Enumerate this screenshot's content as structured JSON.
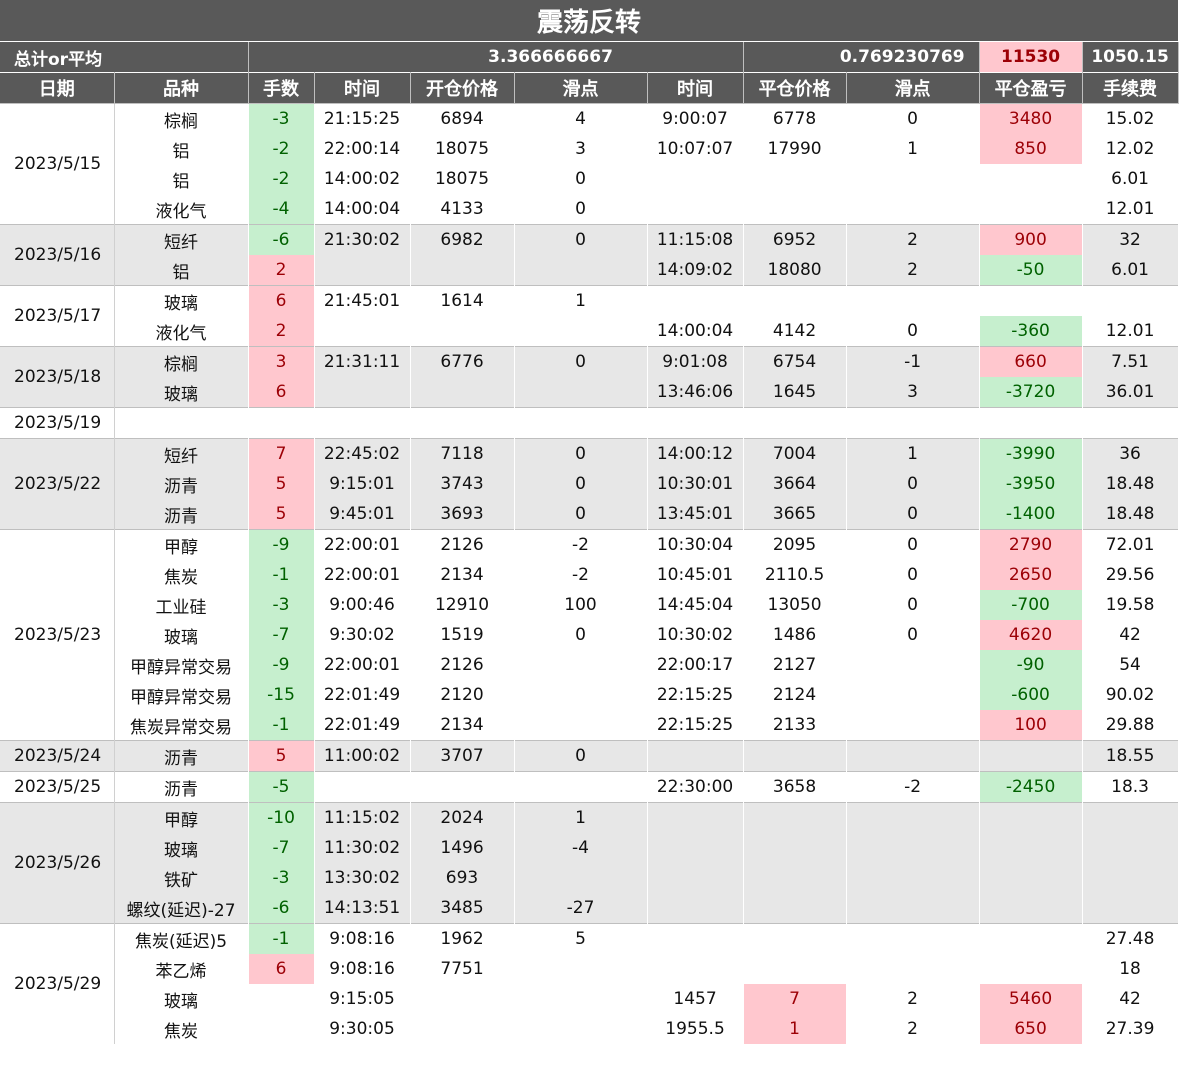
{
  "title": "震荡反转",
  "summary": {
    "label": "总计or平均",
    "avg_open_slip": "3.366666667",
    "avg_close_slip": "0.769230769",
    "total_pnl": "11530",
    "total_fee": "1050.15"
  },
  "headers": [
    "日期",
    "品种",
    "手数",
    "时间",
    "开仓价格",
    "滑点",
    "时间",
    "平仓价格",
    "滑点",
    "平仓盈亏",
    "手续费"
  ],
  "groups": [
    {
      "date": "2023/5/15",
      "rows": [
        [
          "棕榈",
          "-3",
          "21:15:25",
          "6894",
          "4",
          "9:00:07",
          "6778",
          "0",
          "3480",
          "15.02"
        ],
        [
          "铝",
          "-2",
          "22:00:14",
          "18075",
          "3",
          "10:07:07",
          "17990",
          "1",
          "850",
          "12.02"
        ],
        [
          "铝",
          "-2",
          "14:00:02",
          "18075",
          "0",
          "",
          "",
          "",
          "",
          "6.01"
        ],
        [
          "液化气",
          "-4",
          "14:00:04",
          "4133",
          "0",
          "",
          "",
          "",
          "",
          "12.01"
        ]
      ]
    },
    {
      "date": "2023/5/16",
      "rows": [
        [
          "短纤",
          "-6",
          "21:30:02",
          "6982",
          "0",
          "11:15:08",
          "6952",
          "2",
          "900",
          "32"
        ],
        [
          "铝",
          "2",
          "",
          "",
          "",
          "14:09:02",
          "18080",
          "2",
          "-50",
          "6.01"
        ]
      ]
    },
    {
      "date": "2023/5/17",
      "rows": [
        [
          "玻璃",
          "6",
          "21:45:01",
          "1614",
          "1",
          "",
          "",
          "",
          "",
          ""
        ],
        [
          "液化气",
          "2",
          "",
          "",
          "",
          "14:00:04",
          "4142",
          "0",
          "-360",
          "12.01"
        ]
      ]
    },
    {
      "date": "2023/5/18",
      "rows": [
        [
          "棕榈",
          "3",
          "21:31:11",
          "6776",
          "0",
          "9:01:08",
          "6754",
          "-1",
          "660",
          "7.51"
        ],
        [
          "玻璃",
          "6",
          "",
          "",
          "",
          "13:46:06",
          "1645",
          "3",
          "-3720",
          "36.01"
        ]
      ]
    },
    {
      "date": "2023/5/19",
      "rows": [
        [
          "",
          "",
          "",
          "",
          "",
          "",
          "",
          "",
          "",
          ""
        ]
      ]
    },
    {
      "date": "2023/5/22",
      "rows": [
        [
          "短纤",
          "7",
          "22:45:02",
          "7118",
          "0",
          "14:00:12",
          "7004",
          "1",
          "-3990",
          "36"
        ],
        [
          "沥青",
          "5",
          "9:15:01",
          "3743",
          "0",
          "10:30:01",
          "3664",
          "0",
          "-3950",
          "18.48"
        ],
        [
          "沥青",
          "5",
          "9:45:01",
          "3693",
          "0",
          "13:45:01",
          "3665",
          "0",
          "-1400",
          "18.48"
        ]
      ]
    },
    {
      "date": "2023/5/23",
      "rows": [
        [
          "甲醇",
          "-9",
          "22:00:01",
          "2126",
          "-2",
          "10:30:04",
          "2095",
          "0",
          "2790",
          "72.01"
        ],
        [
          "焦炭",
          "-1",
          "22:00:01",
          "2134",
          "-2",
          "10:45:01",
          "2110.5",
          "0",
          "2650",
          "29.56"
        ],
        [
          "工业硅",
          "-3",
          "9:00:46",
          "12910",
          "100",
          "14:45:04",
          "13050",
          "0",
          "-700",
          "19.58"
        ],
        [
          "玻璃",
          "-7",
          "9:30:02",
          "1519",
          "0",
          "10:30:02",
          "1486",
          "0",
          "4620",
          "42"
        ],
        [
          "甲醇异常交易",
          "-9",
          "22:00:01",
          "2126",
          "",
          "22:00:17",
          "2127",
          "",
          "-90",
          "54"
        ],
        [
          "甲醇异常交易",
          "-15",
          "22:01:49",
          "2120",
          "",
          "22:15:25",
          "2124",
          "",
          "-600",
          "90.02"
        ],
        [
          "焦炭异常交易",
          "-1",
          "22:01:49",
          "2134",
          "",
          "22:15:25",
          "2133",
          "",
          "100",
          "29.88"
        ]
      ]
    },
    {
      "date": "2023/5/24",
      "rows": [
        [
          "沥青",
          "5",
          "11:00:02",
          "3707",
          "0",
          "",
          "",
          "",
          "",
          "18.55"
        ]
      ]
    },
    {
      "date": "2023/5/25",
      "rows": [
        [
          "沥青",
          "-5",
          "",
          "",
          "",
          "22:30:00",
          "3658",
          "-2",
          "-2450",
          "18.3"
        ]
      ]
    },
    {
      "date": "2023/5/26",
      "rows": [
        [
          "甲醇",
          "-10",
          "11:15:02",
          "2024",
          "1",
          "",
          "",
          "",
          "",
          ""
        ],
        [
          "玻璃",
          "-7",
          "11:30:02",
          "1496",
          "-4",
          "",
          "",
          "",
          "",
          ""
        ],
        [
          "铁矿",
          "-3",
          "13:30:02",
          "693",
          "",
          "",
          "",
          "",
          "",
          ""
        ],
        [
          "螺纹(延迟)-27",
          "-6",
          "14:13:51",
          "3485",
          "-27",
          "",
          "",
          "",
          "",
          ""
        ]
      ]
    },
    {
      "date": "2023/5/29",
      "rows": [
        [
          "焦炭(延迟)5",
          "-1",
          "9:08:16",
          "1962",
          "5",
          "",
          "",
          "",
          "",
          "27.48"
        ],
        [
          "苯乙烯",
          "6",
          "9:08:16",
          "7751",
          "",
          "",
          "",
          "",
          "",
          "18"
        ],
        [
          "玻璃",
          "",
          "9:15:05",
          "",
          "",
          "1457",
          "7",
          "2",
          "5460",
          "42"
        ],
        [
          "焦炭",
          "",
          "9:30:05",
          "",
          "",
          "1955.5",
          "1",
          "2",
          "650",
          "27.39"
        ]
      ]
    }
  ],
  "colors": {
    "header_bg": "#595959",
    "negative_fill": "#c6efce",
    "negative_text": "#006100",
    "positive_fill": "#ffc7ce",
    "positive_text": "#9c0006",
    "alt_row": "#e7e7e7"
  }
}
